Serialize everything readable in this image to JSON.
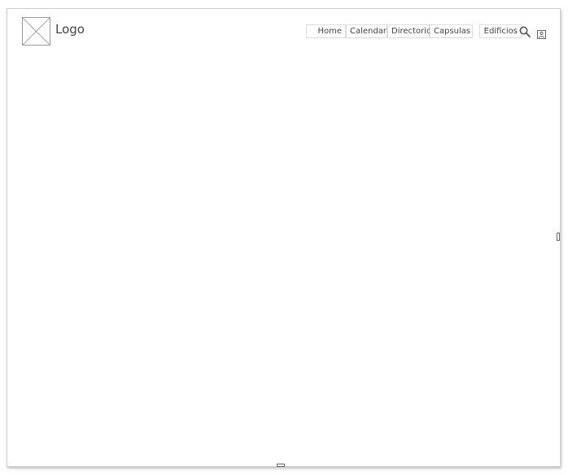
{
  "header": {
    "logo_text": "Logo",
    "nav": [
      {
        "label": "Home"
      },
      {
        "label": "Calendario"
      },
      {
        "label": "Directorio"
      },
      {
        "label": "Capsulas"
      },
      {
        "label": "Edificios"
      }
    ],
    "icons": {
      "search": "search-icon",
      "user": "user-icon"
    }
  },
  "colors": {
    "border": "#cfcfcf",
    "text": "#444444",
    "background": "#ffffff"
  }
}
